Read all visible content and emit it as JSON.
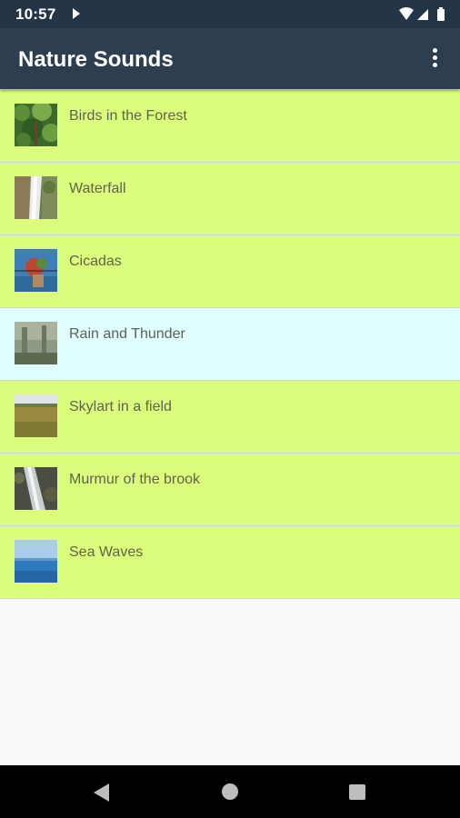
{
  "status_bar": {
    "time": "10:57",
    "icons": [
      "play-icon",
      "wifi-icon",
      "signal-icon",
      "battery-icon"
    ]
  },
  "app_bar": {
    "title": "Nature Sounds",
    "menu_icon": "more-vert-icon"
  },
  "colors": {
    "status_bar": "#253548",
    "app_bar": "#2d3e50",
    "item_default": "#dcfd7b",
    "item_selected": "#e0fdff",
    "item_text": "#5b6453",
    "background": "#fafafa"
  },
  "sounds": [
    {
      "label": "Birds in the Forest",
      "thumb": "forest-thumbnail",
      "selected": false
    },
    {
      "label": "Waterfall",
      "thumb": "waterfall-thumbnail",
      "selected": false
    },
    {
      "label": "Cicadas",
      "thumb": "cicadas-thumbnail",
      "selected": false
    },
    {
      "label": "Rain and Thunder",
      "thumb": "rain-thumbnail",
      "selected": true
    },
    {
      "label": "Skylart in a field",
      "thumb": "field-thumbnail",
      "selected": false
    },
    {
      "label": "Murmur of the brook",
      "thumb": "brook-thumbnail",
      "selected": false
    },
    {
      "label": "Sea Waves",
      "thumb": "sea-thumbnail",
      "selected": false
    }
  ],
  "nav_bar": {
    "buttons": [
      "back-icon",
      "home-icon",
      "recents-icon"
    ]
  }
}
